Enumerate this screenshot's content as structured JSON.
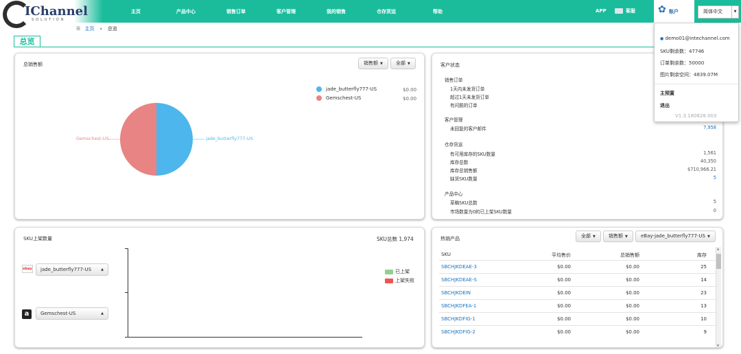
{
  "brand": {
    "logo_main": "IChannel",
    "logo_sub": "SOLUTION"
  },
  "nav": [
    "主页",
    "产品中心",
    "销售订单",
    "客户管理",
    "我的销售",
    "仓存货运",
    "帮助"
  ],
  "header": {
    "app": "APP",
    "service": "客服",
    "account": "账户",
    "language": "简体中文"
  },
  "breadcrumb": {
    "home": "主页",
    "current": "总览"
  },
  "page_title": "总览",
  "account_menu": {
    "email": "demo01@intechannel.com",
    "sku_left": "SKU剩余数：47746",
    "order_left": "订单剩余数：50000",
    "space_left": "图片剩余空间：4839.07M",
    "home": "主预置",
    "logout": "退出",
    "version": "V1.3.180828.003"
  },
  "sales_panel": {
    "title": "总销售额",
    "btn_metric": "销售额",
    "btn_scope": "全部",
    "legend": [
      {
        "name": "jade_butterfly777-US",
        "value": "$0.00",
        "color": "#4db6ec"
      },
      {
        "name": "Gemschest-US",
        "value": "$0.00",
        "color": "#e88484"
      }
    ],
    "pie_label_left": "Gemschest-US",
    "pie_label_right": "jade_butterfly777-US"
  },
  "status_panel": {
    "title": "客户状态",
    "sections": [
      {
        "header": "销售订单",
        "rows": [
          {
            "label": "1天内未发货订单",
            "value": ""
          },
          {
            "label": "超过1天未发货订单",
            "value": ""
          },
          {
            "label": "有问题的订单",
            "value": ""
          }
        ]
      },
      {
        "header": "客户管理",
        "rows": [
          {
            "label": "未回复的客户邮件",
            "value": "7,958"
          }
        ]
      },
      {
        "header": "仓存货运",
        "rows": [
          {
            "label": "有可用库存的SKU数量",
            "value": "1,561"
          },
          {
            "label": "库存总数",
            "value": "40,350"
          },
          {
            "label": "库存总销售额",
            "value": "$710,966.21"
          },
          {
            "label": "缺货SKU数量",
            "value": "5"
          }
        ]
      },
      {
        "header": "产品中心",
        "rows": [
          {
            "label": "草稿SKU总数",
            "value": "5"
          },
          {
            "label": "市场数量为0的已上架SKU数量",
            "value": "0"
          }
        ]
      }
    ]
  },
  "sku_panel": {
    "title": "SKU上架数量",
    "total": "SKU总数 1,974",
    "stores": [
      {
        "name": "jade_butterfly777-US",
        "icon": "ebay-icon"
      },
      {
        "name": "Gemschest-US",
        "icon": "amazon-icon"
      }
    ],
    "legend": [
      {
        "name": "已上架",
        "color": "#8fd18f"
      },
      {
        "name": "上架失败",
        "color": "#ee5555"
      }
    ]
  },
  "hot_panel": {
    "title": "热销产品",
    "btn_scope": "全部",
    "btn_metric": "销售额",
    "btn_store": "eBay-jade_butterfly777-US",
    "columns": [
      "SKU",
      "平均售价",
      "总销售额",
      "库存"
    ],
    "rows": [
      [
        "SBCHJKDEAE-3",
        "$0.00",
        "$0.00",
        "25"
      ],
      [
        "SBCHJKDEAE-S",
        "$0.00",
        "$0.00",
        "14"
      ],
      [
        "SBCHJKDEIN",
        "$0.00",
        "$0.00",
        "23"
      ],
      [
        "SBCHJKDFEA-1",
        "$0.00",
        "$0.00",
        "13"
      ],
      [
        "SBCHJKDFIG-1",
        "$0.00",
        "$0.00",
        "10"
      ],
      [
        "SBCHJKDFIG-2",
        "$0.00",
        "$0.00",
        "9"
      ]
    ]
  },
  "colors": {
    "accent": "#1abc9c",
    "link": "#1a73c0"
  }
}
